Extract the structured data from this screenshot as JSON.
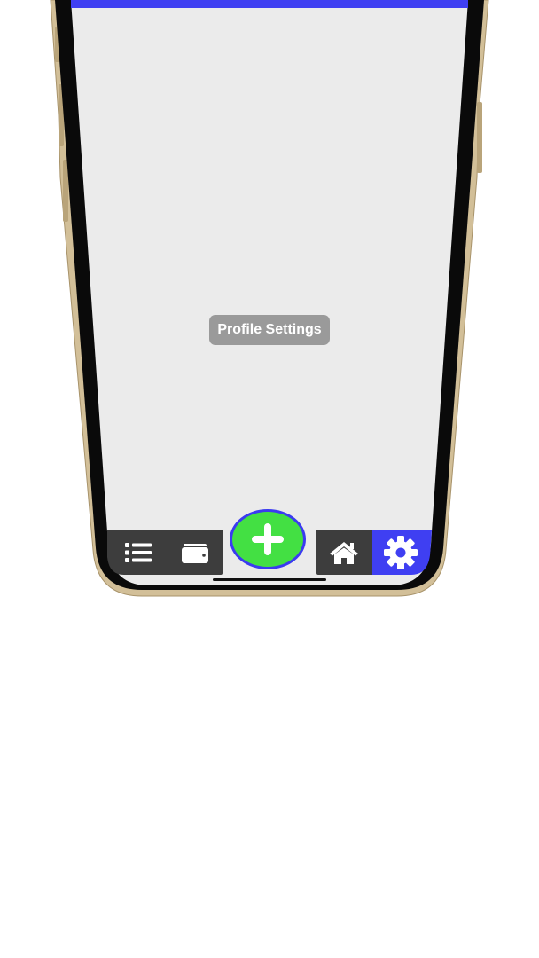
{
  "screen": {
    "label": "Profile Settings",
    "accent_color": "#3f3ff2",
    "background_color": "#ebebeb"
  },
  "tab_bar": {
    "items": [
      {
        "id": "list",
        "icon": "list-icon",
        "active": false
      },
      {
        "id": "wallet",
        "icon": "wallet-icon",
        "active": false
      },
      {
        "id": "add",
        "icon": "plus-icon",
        "active": false,
        "color": "#43e043"
      },
      {
        "id": "home",
        "icon": "home-icon",
        "active": false
      },
      {
        "id": "settings",
        "icon": "gear-icon",
        "active": true
      }
    ],
    "bar_color": "#3d3d3d",
    "active_color": "#3f3ff2"
  },
  "device": {
    "frame_color": "#c8b48c"
  }
}
